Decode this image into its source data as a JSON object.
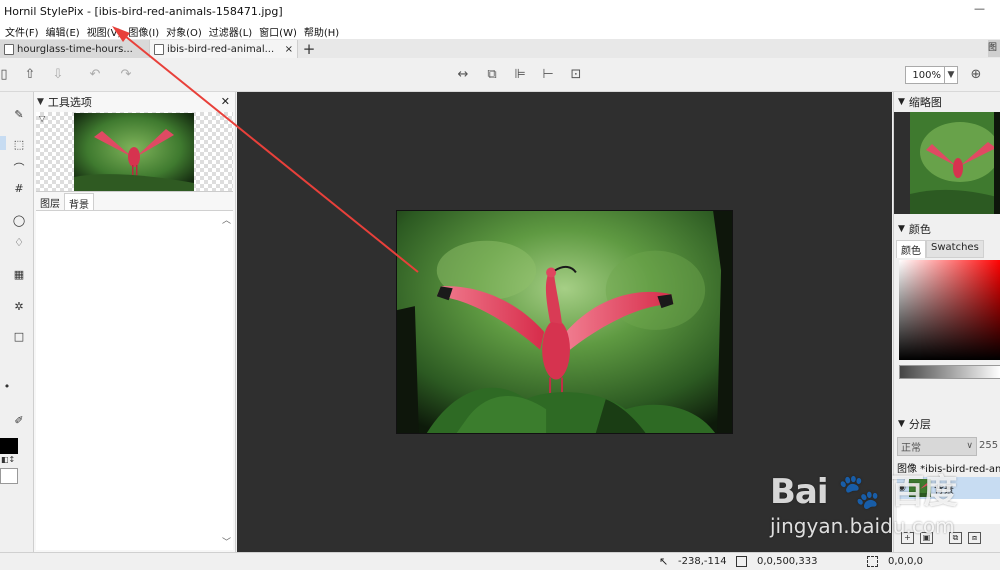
{
  "window": {
    "title": "Hornil StylePix - [ibis-bird-red-animals-158471.jpg]"
  },
  "menubar": {
    "items": [
      "文件(F)",
      "编辑(E)",
      "视图(V)",
      "图像(I)",
      "对象(O)",
      "过滤器(L)",
      "窗口(W)",
      "帮助(H)"
    ]
  },
  "tabs": [
    {
      "label": "hourglass-time-hours...",
      "active": true
    },
    {
      "label": "ibis-bird-red-animal...",
      "active": false
    }
  ],
  "tabbar": {
    "add": "+",
    "close": "×",
    "right_stub": "图"
  },
  "toolbar": {
    "zoom": "100%"
  },
  "tool_panel": {
    "title": "工具选项",
    "subtabs": [
      "图层",
      "背景"
    ]
  },
  "right_panel": {
    "thumbnail_title": "缩略图",
    "color_title": "颜色",
    "color_tabs": [
      "颜色",
      "Swatches"
    ],
    "layers_title": "分层",
    "blend_mode": "正常",
    "opacity": "255",
    "image_label": "图像 *ibis-bird-red-animals",
    "layer_name": "背景"
  },
  "statusbar": {
    "pointer": "-238,-114",
    "selection": "0,0,500,333",
    "extra": "0,0,0,0"
  },
  "watermark": {
    "url": "jingyan.baidu.com"
  },
  "colors": {
    "canvas_bg": "#2f2f2f",
    "selected": "#c7dcf2",
    "arrow": "#e8403a"
  }
}
